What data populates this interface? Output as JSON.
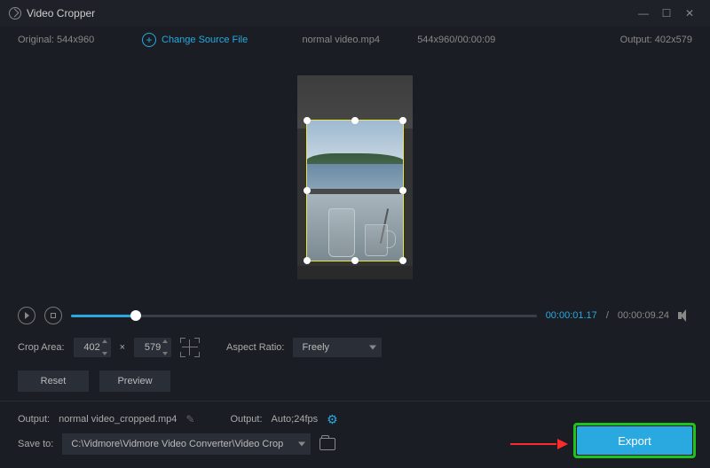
{
  "title": "Video Cropper",
  "infobar": {
    "original_label": "Original:",
    "original_dims": "544x960",
    "change_label": "Change Source File",
    "filename": "normal video.mp4",
    "src_info": "544x960/00:00:09",
    "output_label": "Output:",
    "output_dims": "402x579"
  },
  "playbar": {
    "current": "00:00:01.17",
    "sep": "/",
    "duration": "00:00:09.24"
  },
  "croprow": {
    "label": "Crop Area:",
    "w": "402",
    "x": "×",
    "h": "579",
    "aspect_label": "Aspect Ratio:",
    "aspect_value": "Freely"
  },
  "buttons": {
    "reset": "Reset",
    "preview": "Preview",
    "export": "Export"
  },
  "output": {
    "label": "Output:",
    "file": "normal video_cropped.mp4",
    "label2": "Output:",
    "fmt": "Auto;24fps"
  },
  "save": {
    "label": "Save to:",
    "path": "C:\\Vidmore\\Vidmore Video Converter\\Video Crop"
  }
}
